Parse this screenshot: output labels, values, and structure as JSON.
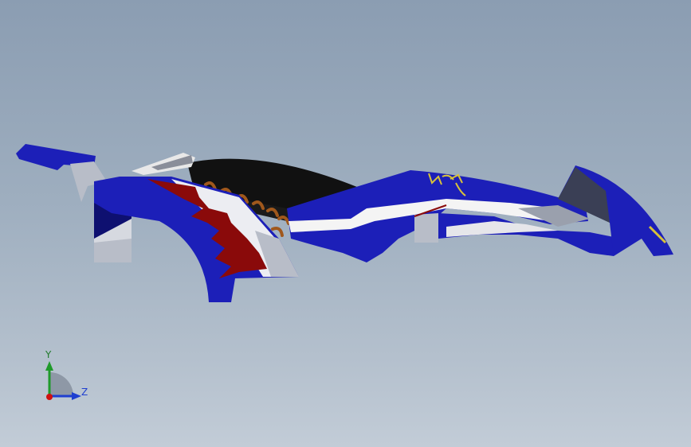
{
  "viewport": {
    "background_top": "#8b9db2",
    "background_bottom": "#c2ccd7"
  },
  "model": {
    "colors": {
      "body_blue": "#1c1fb8",
      "body_blue_dark": "#0e1070",
      "stripe_red": "#8a0a0a",
      "stripe_white": "#f4f4f4",
      "panel_gray": "#b8bdc8",
      "canopy_black": "#111111",
      "spring_orange": "#a0581c",
      "decal_yellow": "#d8c23a"
    }
  },
  "triad": {
    "y_label": "Y",
    "z_label": "Z",
    "y_color": "#1f9a2a",
    "z_color": "#1f3fd0",
    "x_color": "#d01010"
  }
}
